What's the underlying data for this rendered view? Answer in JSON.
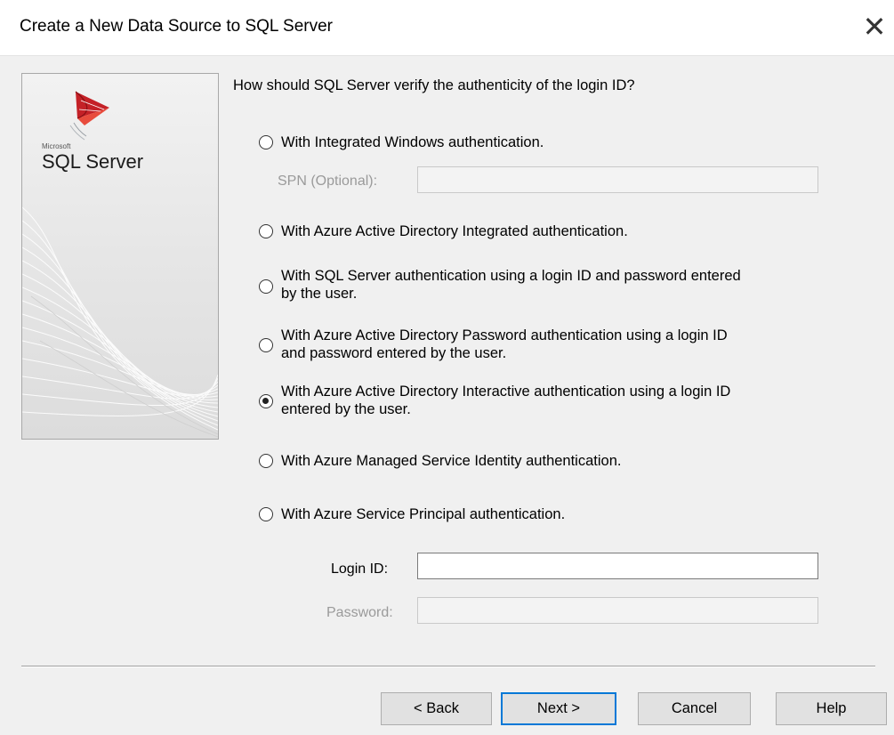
{
  "window": {
    "title": "Create a New Data Source to SQL Server",
    "close_glyph": "✕"
  },
  "brand": {
    "vendor": "Microsoft",
    "product": "SQL Server"
  },
  "question": "How should SQL Server verify the authenticity of the login ID?",
  "options": [
    {
      "lines": [
        "With Integrated Windows authentication."
      ],
      "checked": false
    },
    {
      "lines": [
        "With Azure Active Directory Integrated authentication."
      ],
      "checked": false
    },
    {
      "lines": [
        "With SQL Server authentication using a login ID and password entered",
        "by the user."
      ],
      "checked": false
    },
    {
      "lines": [
        "With Azure Active Directory Password authentication using a login ID",
        "and password entered by the user."
      ],
      "checked": false
    },
    {
      "lines": [
        "With Azure Active Directory Interactive authentication using a login ID",
        "entered by the user."
      ],
      "checked": true
    },
    {
      "lines": [
        "With Azure Managed Service Identity authentication."
      ],
      "checked": false
    },
    {
      "lines": [
        "With Azure Service Principal authentication."
      ],
      "checked": false
    }
  ],
  "spn": {
    "label": "SPN (Optional):",
    "value": "",
    "enabled": false
  },
  "login": {
    "label": "Login ID:",
    "value": "",
    "enabled": true
  },
  "password": {
    "label": "Password:",
    "value": "",
    "enabled": false
  },
  "buttons": {
    "back": "< Back",
    "next": "Next >",
    "cancel": "Cancel",
    "help": "Help"
  },
  "colors": {
    "default_button_border": "#0078d7",
    "dialog_background": "#f0f0f0",
    "disabled_text": "#9a9a9a"
  }
}
